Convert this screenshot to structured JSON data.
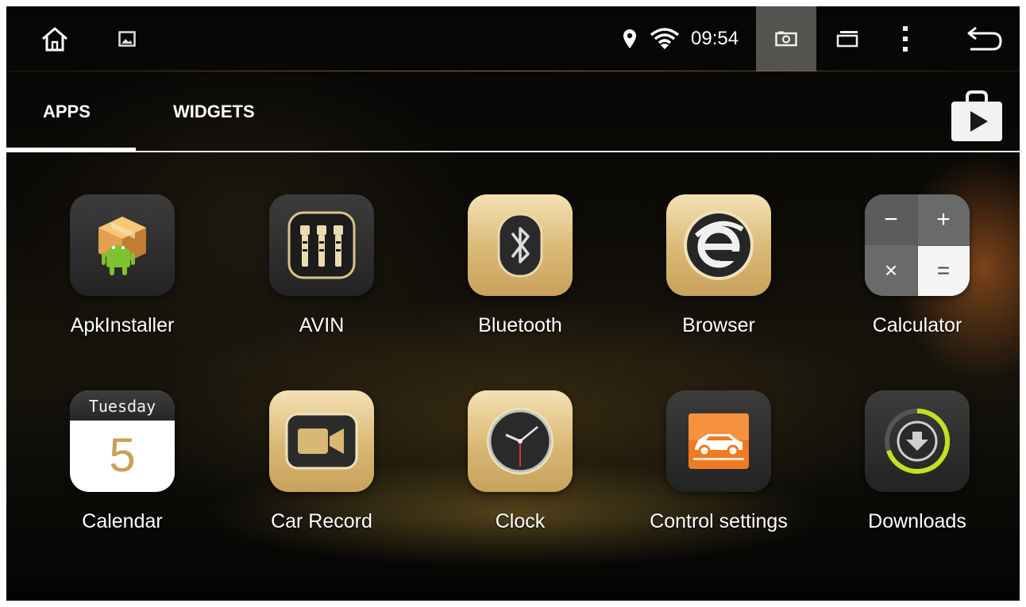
{
  "status_bar": {
    "home_icon": "home-icon",
    "gallery_icon": "gallery-icon",
    "location_icon": "location-icon",
    "wifi_icon": "wifi-icon",
    "time": "09:54",
    "screenshot_icon": "screenshot-icon",
    "recents_icon": "recent-apps-icon",
    "menu_icon": "overflow-menu-icon",
    "back_icon": "back-icon"
  },
  "tabs": [
    {
      "label": "APPS",
      "active": true
    },
    {
      "label": "WIDGETS",
      "active": false
    }
  ],
  "play_store_icon": "play-store-icon",
  "apps": [
    {
      "label": "ApkInstaller",
      "icon": "apk-installer-icon"
    },
    {
      "label": "AVIN",
      "icon": "avin-icon"
    },
    {
      "label": "Bluetooth",
      "icon": "bluetooth-icon"
    },
    {
      "label": "Browser",
      "icon": "browser-icon"
    },
    {
      "label": "Calculator",
      "icon": "calculator-icon",
      "keys": [
        "−",
        "+",
        "×",
        "="
      ]
    },
    {
      "label": "Calendar",
      "icon": "calendar-icon",
      "day_name": "Tuesday",
      "day_number": "5"
    },
    {
      "label": "Car Record",
      "icon": "car-record-icon"
    },
    {
      "label": "Clock",
      "icon": "clock-icon"
    },
    {
      "label": "Control settings",
      "icon": "control-settings-icon"
    },
    {
      "label": "Downloads",
      "icon": "downloads-icon"
    }
  ],
  "colors": {
    "accent_gold": "#d9b874",
    "tile_dark": "#2e2e2e",
    "download_ring": "#c6e020",
    "control_orange": "#f07a22"
  }
}
